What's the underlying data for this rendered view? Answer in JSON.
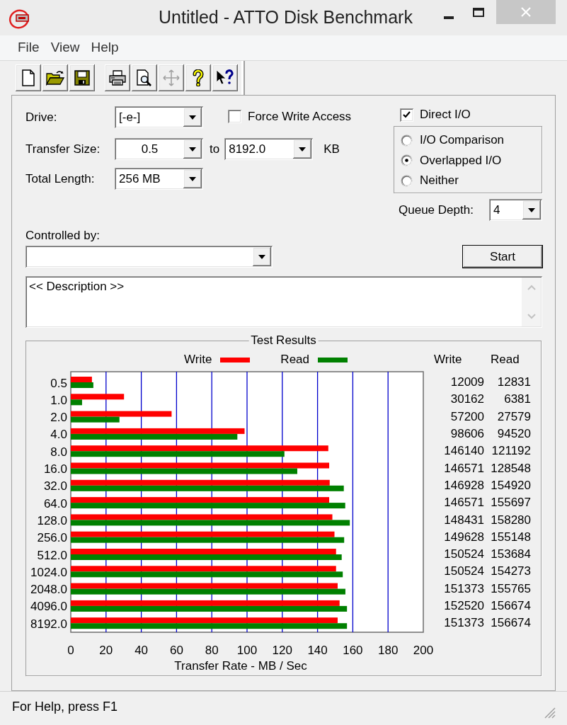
{
  "window": {
    "title": "Untitled - ATTO Disk Benchmark"
  },
  "menu": [
    "File",
    "View",
    "Help"
  ],
  "toolbar": {
    "groups": [
      [
        {
          "kind": "new",
          "disabled": false
        },
        {
          "kind": "open",
          "disabled": false
        },
        {
          "kind": "save",
          "disabled": false
        }
      ],
      [
        {
          "kind": "print",
          "disabled": false
        },
        {
          "kind": "preview",
          "disabled": false
        },
        {
          "kind": "move",
          "disabled": true
        },
        {
          "kind": "help",
          "disabled": false
        },
        {
          "kind": "context_help",
          "disabled": false
        }
      ]
    ]
  },
  "settings": {
    "drive": {
      "label": "Drive:",
      "value": "[-e-]"
    },
    "force_write_access": {
      "label": "Force Write Access",
      "checked": false
    },
    "direct_io": {
      "label": "Direct I/O",
      "checked": true
    },
    "transfer_size": {
      "label": "Transfer Size:",
      "from": "0.5",
      "separator": "to",
      "to": "8192.0",
      "unit": "KB"
    },
    "io_mode": [
      {
        "label": "I/O Comparison",
        "selected": false
      },
      {
        "label": "Overlapped I/O",
        "selected": true
      },
      {
        "label": "Neither",
        "selected": false
      }
    ],
    "total_length": {
      "label": "Total Length:",
      "value": "256 MB"
    },
    "queue_depth": {
      "label": "Queue Depth:",
      "value": "4"
    },
    "controlled_by": {
      "label": "Controlled by:"
    },
    "start_button": {
      "label": "Start"
    },
    "description": {
      "value": "<< Description >>"
    }
  },
  "test_results": {
    "title": "Test Results",
    "chart_data": {
      "type": "bar",
      "orientation": "horizontal",
      "grid": true,
      "xlabel": "Transfer Rate - MB / Sec",
      "categories": [
        "0.5",
        "1.0",
        "2.0",
        "4.0",
        "8.0",
        "16.0",
        "32.0",
        "64.0",
        "128.0",
        "256.0",
        "512.0",
        "1024.0",
        "2048.0",
        "4096.0",
        "8192.0"
      ],
      "series": [
        {
          "name": "Write",
          "color": "#ff0000",
          "values": [
            12.0,
            30.2,
            57.2,
            98.6,
            146.1,
            146.6,
            146.9,
            146.6,
            148.4,
            149.6,
            150.5,
            150.5,
            151.4,
            152.5,
            151.4
          ]
        },
        {
          "name": "Read",
          "color": "#008000",
          "values": [
            12.8,
            6.4,
            27.6,
            94.5,
            121.2,
            128.5,
            154.9,
            155.7,
            158.3,
            155.1,
            153.7,
            154.3,
            155.8,
            156.7,
            156.7
          ]
        }
      ],
      "xlim": [
        0,
        200
      ],
      "xticks": [
        0,
        20,
        40,
        60,
        80,
        100,
        120,
        140,
        160,
        180,
        200
      ]
    },
    "table": {
      "columns": [
        "Write",
        "Read"
      ],
      "rows": [
        [
          "12009",
          "12831"
        ],
        [
          "30162",
          "6381"
        ],
        [
          "57200",
          "27579"
        ],
        [
          "98606",
          "94520"
        ],
        [
          "146140",
          "121192"
        ],
        [
          "146571",
          "128548"
        ],
        [
          "146928",
          "154920"
        ],
        [
          "146571",
          "155697"
        ],
        [
          "148431",
          "158280"
        ],
        [
          "149628",
          "155148"
        ],
        [
          "150524",
          "153684"
        ],
        [
          "150524",
          "154273"
        ],
        [
          "151373",
          "155765"
        ],
        [
          "152520",
          "156674"
        ],
        [
          "151373",
          "156674"
        ]
      ]
    }
  },
  "status_bar": {
    "text": "For Help, press F1"
  }
}
